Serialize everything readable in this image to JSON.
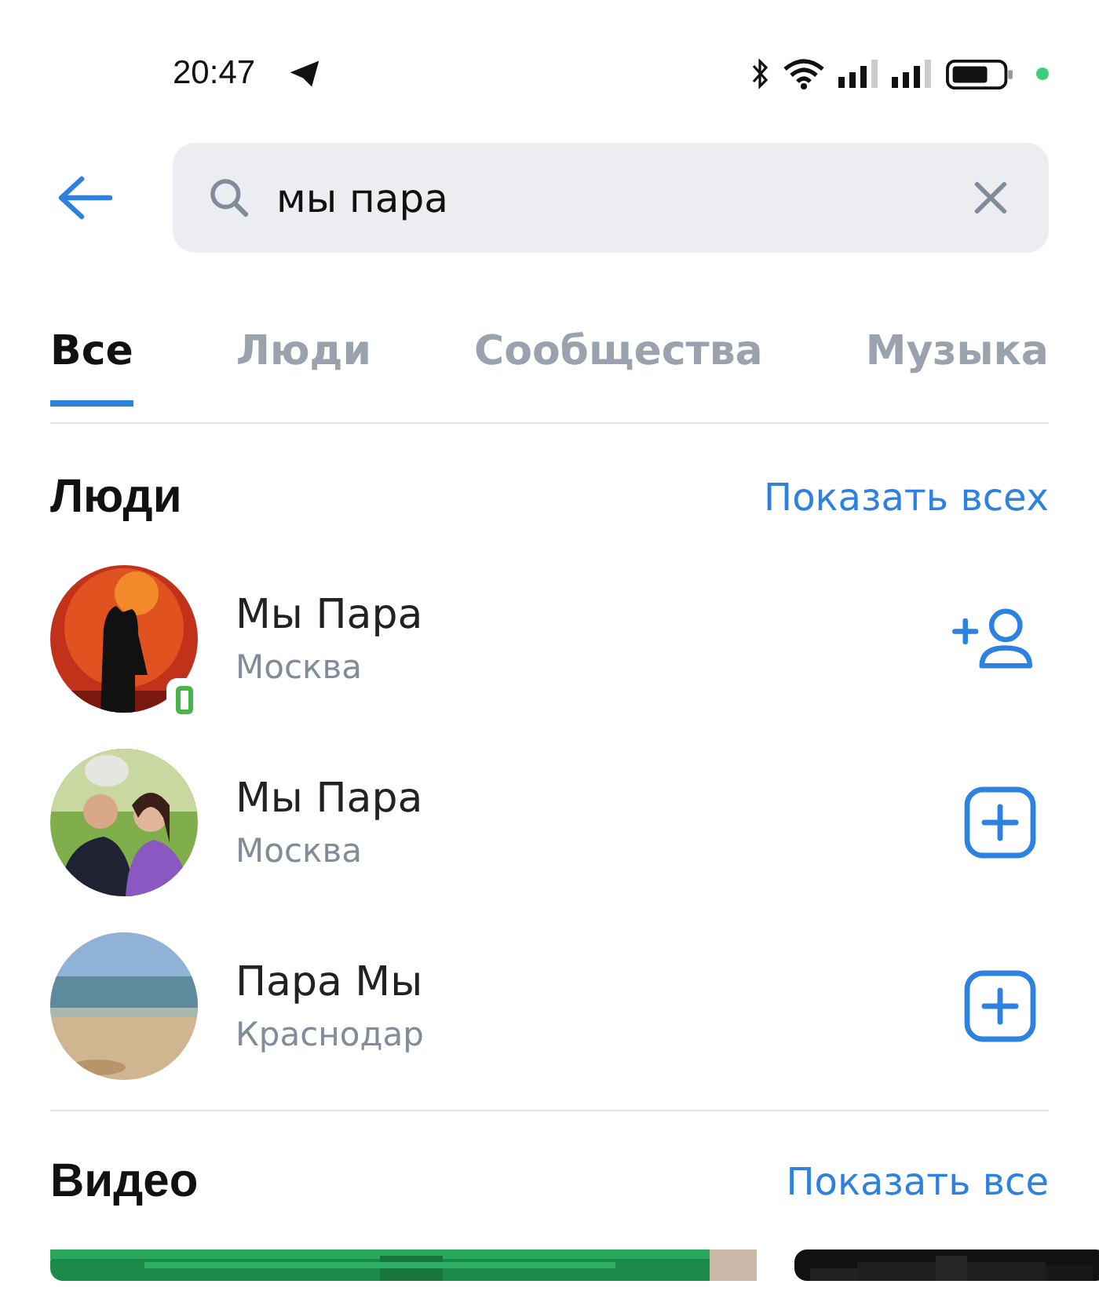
{
  "status_bar": {
    "time": "20:47"
  },
  "search": {
    "value": "мы пара"
  },
  "tabs": [
    {
      "label": "Все",
      "selected": true
    },
    {
      "label": "Люди",
      "selected": false
    },
    {
      "label": "Сообщества",
      "selected": false
    },
    {
      "label": "Музыка",
      "selected": false
    }
  ],
  "people": {
    "title": "Люди",
    "show_all": "Показать всех",
    "items": [
      {
        "name": "Мы Пара",
        "city": "Москва",
        "online_mobile": true,
        "kind": "add-friend"
      },
      {
        "name": "Мы Пара",
        "city": "Москва",
        "online_mobile": false,
        "kind": "add"
      },
      {
        "name": "Пара Мы",
        "city": "Краснодар",
        "online_mobile": false,
        "kind": "add"
      }
    ]
  },
  "video": {
    "title": "Видео",
    "show_all": "Показать все"
  }
}
